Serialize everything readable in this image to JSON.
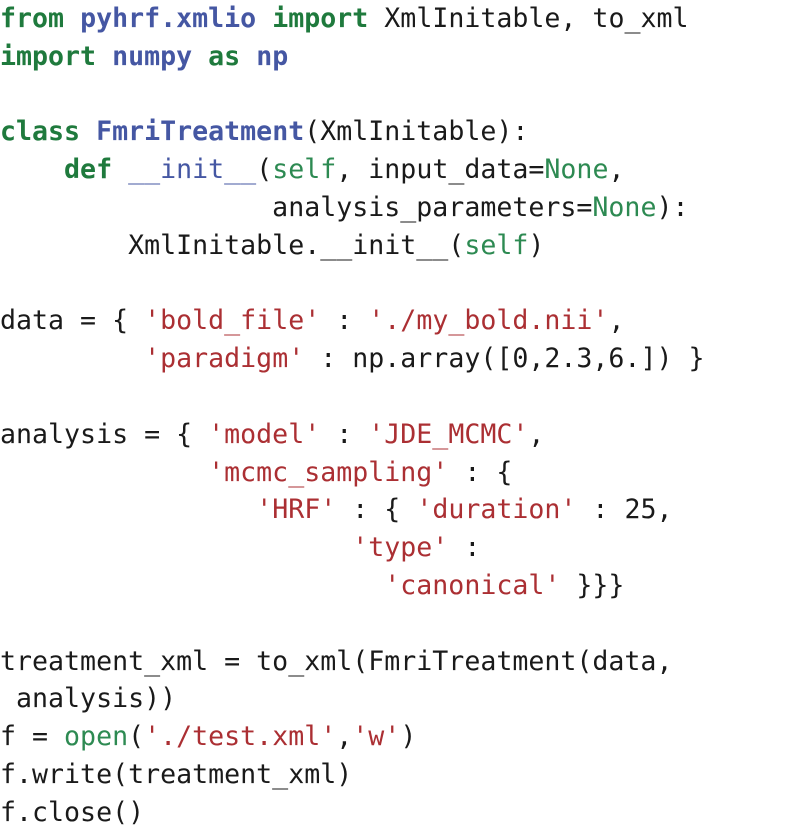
{
  "document": {
    "kind": "source-code-listing",
    "language": "Python",
    "background_color": "#ffffff",
    "font_size_px": 26.6,
    "line_height_px": 37.8
  },
  "palette": {
    "keyword": "#1f7a3d",
    "module": "#4557a3",
    "function": "#4557a3",
    "builtin": "#2d8a52",
    "string": "#ab2f33",
    "plain": "#1a1a1a"
  },
  "code": {
    "lines": [
      {
        "id": "line-1",
        "tokens": [
          {
            "t": "from",
            "c": "kw"
          },
          {
            "t": " ",
            "c": "plain"
          },
          {
            "t": "pyhrf.xmlio",
            "c": "mod"
          },
          {
            "t": " ",
            "c": "plain"
          },
          {
            "t": "import",
            "c": "kw"
          },
          {
            "t": " XmlInitable, to_xml",
            "c": "plain"
          }
        ]
      },
      {
        "id": "line-2",
        "tokens": [
          {
            "t": "import",
            "c": "kw"
          },
          {
            "t": " ",
            "c": "plain"
          },
          {
            "t": "numpy",
            "c": "mod"
          },
          {
            "t": " ",
            "c": "plain"
          },
          {
            "t": "as",
            "c": "kw"
          },
          {
            "t": " ",
            "c": "plain"
          },
          {
            "t": "np",
            "c": "mod"
          }
        ]
      },
      {
        "id": "line-3",
        "tokens": []
      },
      {
        "id": "line-4",
        "tokens": [
          {
            "t": "class",
            "c": "kw"
          },
          {
            "t": " ",
            "c": "plain"
          },
          {
            "t": "FmriTreatment",
            "c": "mod"
          },
          {
            "t": "(XmlInitable):",
            "c": "plain"
          }
        ]
      },
      {
        "id": "line-5",
        "tokens": [
          {
            "t": "    ",
            "c": "plain"
          },
          {
            "t": "def",
            "c": "kw"
          },
          {
            "t": " ",
            "c": "plain"
          },
          {
            "t": "__init__",
            "c": "fn"
          },
          {
            "t": "(",
            "c": "plain"
          },
          {
            "t": "self",
            "c": "builtin"
          },
          {
            "t": ", input_data=",
            "c": "plain"
          },
          {
            "t": "None",
            "c": "builtin"
          },
          {
            "t": ",",
            "c": "plain"
          }
        ]
      },
      {
        "id": "line-6",
        "tokens": [
          {
            "t": "                 analysis_parameters=",
            "c": "plain"
          },
          {
            "t": "None",
            "c": "builtin"
          },
          {
            "t": "):",
            "c": "plain"
          }
        ]
      },
      {
        "id": "line-7",
        "tokens": [
          {
            "t": "        XmlInitable.__init__(",
            "c": "plain"
          },
          {
            "t": "self",
            "c": "builtin"
          },
          {
            "t": ")",
            "c": "plain"
          }
        ]
      },
      {
        "id": "line-8",
        "tokens": []
      },
      {
        "id": "line-9",
        "tokens": [
          {
            "t": "data = { ",
            "c": "plain"
          },
          {
            "t": "'bold_file'",
            "c": "str"
          },
          {
            "t": " : ",
            "c": "plain"
          },
          {
            "t": "'./my_bold.nii'",
            "c": "str"
          },
          {
            "t": ",",
            "c": "plain"
          }
        ]
      },
      {
        "id": "line-10",
        "tokens": [
          {
            "t": "         ",
            "c": "plain"
          },
          {
            "t": "'paradigm'",
            "c": "str"
          },
          {
            "t": " : np.array([0,2.3,6.]) }",
            "c": "plain"
          }
        ]
      },
      {
        "id": "line-11",
        "tokens": []
      },
      {
        "id": "line-12",
        "tokens": [
          {
            "t": "analysis = { ",
            "c": "plain"
          },
          {
            "t": "'model'",
            "c": "str"
          },
          {
            "t": " : ",
            "c": "plain"
          },
          {
            "t": "'JDE_MCMC'",
            "c": "str"
          },
          {
            "t": ",",
            "c": "plain"
          }
        ]
      },
      {
        "id": "line-13",
        "tokens": [
          {
            "t": "             ",
            "c": "plain"
          },
          {
            "t": "'mcmc_sampling'",
            "c": "str"
          },
          {
            "t": " : {",
            "c": "plain"
          }
        ]
      },
      {
        "id": "line-14",
        "tokens": [
          {
            "t": "                ",
            "c": "plain"
          },
          {
            "t": "'HRF'",
            "c": "str"
          },
          {
            "t": " : { ",
            "c": "plain"
          },
          {
            "t": "'duration'",
            "c": "str"
          },
          {
            "t": " : ",
            "c": "plain"
          },
          {
            "t": "25",
            "c": "num"
          },
          {
            "t": ",",
            "c": "plain"
          }
        ]
      },
      {
        "id": "line-15",
        "tokens": [
          {
            "t": "                      ",
            "c": "plain"
          },
          {
            "t": "'type'",
            "c": "str"
          },
          {
            "t": " :",
            "c": "plain"
          }
        ]
      },
      {
        "id": "line-16",
        "tokens": [
          {
            "t": "                        ",
            "c": "plain"
          },
          {
            "t": "'canonical'",
            "c": "str"
          },
          {
            "t": " }}}",
            "c": "plain"
          }
        ]
      },
      {
        "id": "line-17",
        "tokens": []
      },
      {
        "id": "line-18",
        "tokens": [
          {
            "t": "treatment_xml = to_xml(FmriTreatment(data,",
            "c": "plain"
          }
        ]
      },
      {
        "id": "line-19",
        "tokens": [
          {
            "t": " analysis))",
            "c": "plain"
          }
        ]
      },
      {
        "id": "line-20",
        "tokens": [
          {
            "t": "f = ",
            "c": "plain"
          },
          {
            "t": "open",
            "c": "builtin"
          },
          {
            "t": "(",
            "c": "plain"
          },
          {
            "t": "'./test.xml'",
            "c": "str"
          },
          {
            "t": ",",
            "c": "plain"
          },
          {
            "t": "'w'",
            "c": "str"
          },
          {
            "t": ")",
            "c": "plain"
          }
        ]
      },
      {
        "id": "line-21",
        "tokens": [
          {
            "t": "f.write(treatment_xml)",
            "c": "plain"
          }
        ]
      },
      {
        "id": "line-22",
        "tokens": [
          {
            "t": "f.close()",
            "c": "plain"
          }
        ]
      }
    ]
  }
}
